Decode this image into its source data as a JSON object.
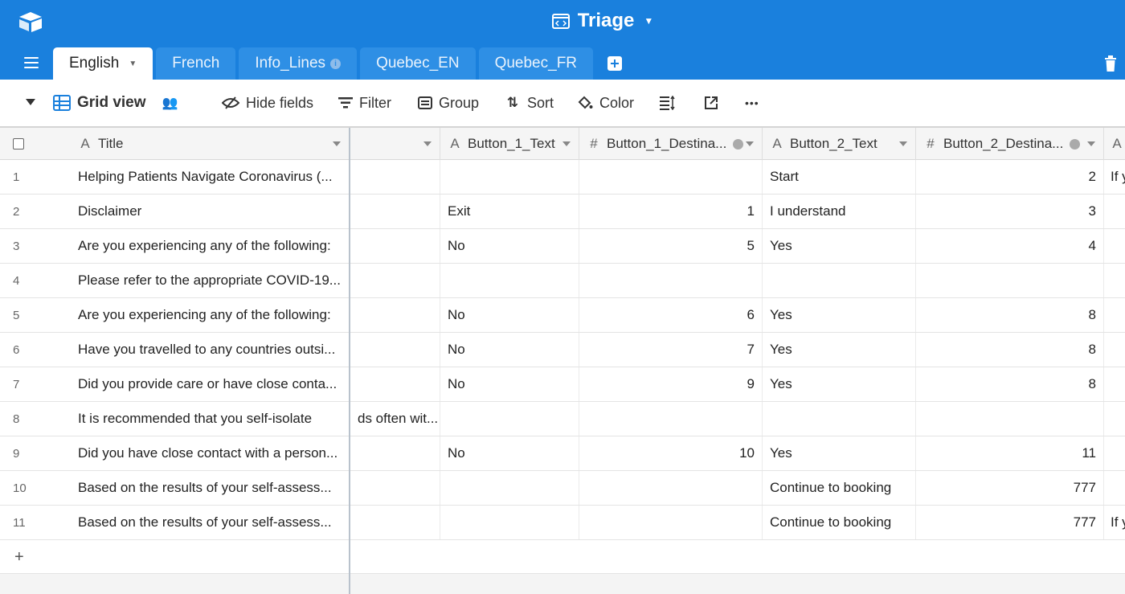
{
  "app": {
    "base_name": "Triage",
    "icons": {
      "logo": "airtable-logo-icon",
      "base": "code-window-icon",
      "menu": "hamburger-icon",
      "trash": "trash-icon"
    },
    "accent": "#1a80dd"
  },
  "tabs": [
    {
      "label": "English",
      "active": true
    },
    {
      "label": "French",
      "active": false
    },
    {
      "label": "Info_Lines",
      "active": false,
      "info": true
    },
    {
      "label": "Quebec_EN",
      "active": false
    },
    {
      "label": "Quebec_FR",
      "active": false
    }
  ],
  "toolbar": {
    "view_name": "Grid view",
    "hide_fields": "Hide fields",
    "filter": "Filter",
    "group": "Group",
    "sort": "Sort",
    "color": "Color",
    "more": "•••"
  },
  "columns": {
    "title": "Title",
    "hidden": "",
    "b1_text": "Button_1_Text",
    "b1_dest": "Button_1_Destina...",
    "b2_text": "Button_2_Text",
    "b2_dest": "Button_2_Destina...",
    "next": ""
  },
  "rows": [
    {
      "n": "1",
      "title": "Helping Patients Navigate Coronavirus (...",
      "hidden": "",
      "b1t": "",
      "b1d": "",
      "b2t": "Start",
      "b2d": "2",
      "next": "If y"
    },
    {
      "n": "2",
      "title": "Disclaimer",
      "hidden": "",
      "b1t": "Exit",
      "b1d": "1",
      "b2t": "I understand",
      "b2d": "3",
      "next": ""
    },
    {
      "n": "3",
      "title": "Are you experiencing any of the following:",
      "hidden": "",
      "b1t": "No",
      "b1d": "5",
      "b2t": "Yes",
      "b2d": "4",
      "next": ""
    },
    {
      "n": "4",
      "title": "Please refer to the appropriate COVID-19...",
      "hidden": "",
      "b1t": "",
      "b1d": "",
      "b2t": "",
      "b2d": "",
      "next": ""
    },
    {
      "n": "5",
      "title": "Are you experiencing any of the following:",
      "hidden": "",
      "b1t": "No",
      "b1d": "6",
      "b2t": "Yes",
      "b2d": "8",
      "next": ""
    },
    {
      "n": "6",
      "title": "Have you travelled to any countries outsi...",
      "hidden": "",
      "b1t": "No",
      "b1d": "7",
      "b2t": "Yes",
      "b2d": "8",
      "next": ""
    },
    {
      "n": "7",
      "title": "Did you provide care or have close conta...",
      "hidden": "",
      "b1t": "No",
      "b1d": "9",
      "b2t": "Yes",
      "b2d": "8",
      "next": ""
    },
    {
      "n": "8",
      "title": "It is recommended that you self-isolate",
      "hidden": "ds often wit...",
      "b1t": "",
      "b1d": "",
      "b2t": "",
      "b2d": "",
      "next": ""
    },
    {
      "n": "9",
      "title": "Did you have close contact with a person...",
      "hidden": "",
      "b1t": "No",
      "b1d": "10",
      "b2t": "Yes",
      "b2d": "11",
      "next": ""
    },
    {
      "n": "10",
      "title": "Based on the results of your self-assess...",
      "hidden": "",
      "b1t": "",
      "b1d": "",
      "b2t": "Continue to booking",
      "b2d": "777",
      "next": ""
    },
    {
      "n": "11",
      "title": "Based on the results of your self-assess...",
      "hidden": "",
      "b1t": "",
      "b1d": "",
      "b2t": "Continue to booking",
      "b2d": "777",
      "next": "If y"
    }
  ],
  "add_row": "+"
}
